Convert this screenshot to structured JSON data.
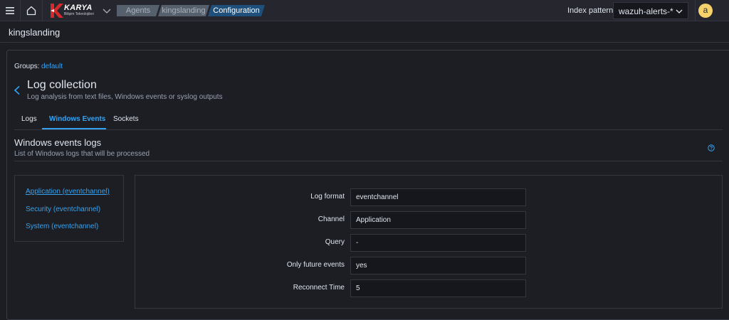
{
  "topbar": {
    "logo": {
      "brand": "KARYA",
      "tagline": "Bilişim Teknolojileri"
    },
    "breadcrumbs": [
      "Agents",
      "kingslanding",
      "Configuration"
    ],
    "index_pattern_label": "Index pattern",
    "index_pattern_value": "wazuh-alerts-*",
    "avatar_initial": "a"
  },
  "agent": {
    "name": "kingslanding"
  },
  "groups": {
    "label": "Groups:",
    "value": "default"
  },
  "section": {
    "title": "Log collection",
    "subtitle": "Log analysis from text files, Windows events or syslog outputs"
  },
  "tabs": [
    {
      "label": "Logs"
    },
    {
      "label": "Windows Events"
    },
    {
      "label": "Sockets"
    }
  ],
  "active_tab": "Windows Events",
  "windows_events": {
    "title": "Windows events logs",
    "subtitle": "List of Windows logs that will be processed",
    "logs": [
      {
        "label": "Application (eventchannel)"
      },
      {
        "label": "Security (eventchannel)"
      },
      {
        "label": "System (eventchannel)"
      }
    ]
  },
  "details": {
    "fields": [
      {
        "label": "Log format",
        "value": "eventchannel"
      },
      {
        "label": "Channel",
        "value": "Application"
      },
      {
        "label": "Query",
        "value": "-"
      },
      {
        "label": "Only future events",
        "value": "yes"
      },
      {
        "label": "Reconnect Time",
        "value": "5"
      }
    ]
  },
  "colors": {
    "accent": "#36a2ef",
    "background": "#1d1e24",
    "topbar": "#25262e",
    "avatar": "#f5d36a",
    "brand_red": "#d42a2a"
  }
}
